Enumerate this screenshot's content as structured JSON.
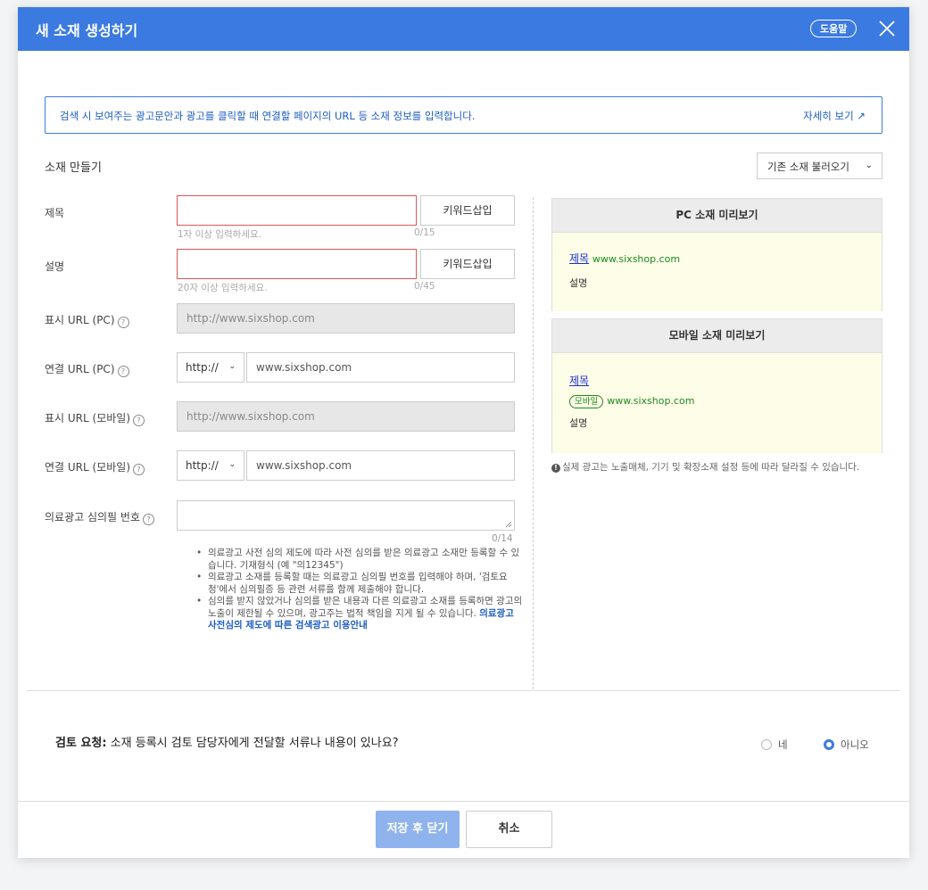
{
  "header": {
    "title": "새 소재 생성하기",
    "help_label": "도움말"
  },
  "info": {
    "text": "검색 시 보여주는 광고문안과 광고를 클릭할 때 연결할 페이지의 URL 등 소재 정보를 입력합니다.",
    "more_label": "자세히 보기 ↗"
  },
  "section": {
    "title": "소재 만들기",
    "import_label": "기존 소재 불러오기"
  },
  "form": {
    "title": {
      "label": "제목",
      "value": "",
      "hint": "1자 이상 입력하세요.",
      "count": "0/15",
      "keyword_btn": "키워드삽입"
    },
    "description": {
      "label": "설명",
      "value": "",
      "hint": "20자 이상 입력하세요.",
      "count": "0/45",
      "keyword_btn": "키워드삽입"
    },
    "display_url_pc": {
      "label": "표시 URL (PC)",
      "value": "http://www.sixshop.com"
    },
    "link_url_pc": {
      "label": "연결 URL (PC)",
      "protocol": "http://",
      "value": "www.sixshop.com"
    },
    "display_url_mobile": {
      "label": "표시 URL (모바일)",
      "value": "http://www.sixshop.com"
    },
    "link_url_mobile": {
      "label": "연결 URL (모바일)",
      "protocol": "http://",
      "value": "www.sixshop.com"
    },
    "medical": {
      "label": "의료광고 심의필 번호",
      "value": "",
      "count": "0/14"
    },
    "bullets": [
      "의료광고 사전 심의 제도에 따라 사전 심의를 받은 의료광고 소재만 등록할 수 있습니다. 기재형식 (예 \"의12345\")",
      "의료광고 소재를 등록할 때는 의료광고 심의필 번호를 입력해야 하며, '검토요청'에서 심의필증 등 관련 서류를 함께 제출해야 합니다.",
      "심의를 받지 않았거나 심의를 받은 내용과 다른 의료광고 소재를 등록하면 광고의 노출이 제한될 수 있으며, 광고주는 법적 책임을 지게 될 수 있습니다. "
    ],
    "bullet_link": "의료광고 사전심의 제도에 따른 검색광고 이용안내"
  },
  "preview": {
    "pc": {
      "header": "PC 소재 미리보기",
      "title": "제목",
      "url": "www.sixshop.com",
      "desc": "설명"
    },
    "mobile": {
      "header": "모바일 소재 미리보기",
      "title": "제목",
      "badge": "모바일",
      "url": "www.sixshop.com",
      "desc": "설명"
    },
    "note": "실제 광고는 노출매체, 기기 및 확장소재 설정 등에 따라 달라질 수 있습니다."
  },
  "review": {
    "label": "검토 요청:",
    "question": " 소재 등록시 검토 담당자에게 전달할 서류나 내용이 있나요?",
    "options": [
      "네",
      "아니오"
    ],
    "selected": "아니오"
  },
  "footer": {
    "save_label": "저장 후 닫기",
    "cancel_label": "취소"
  },
  "colors": {
    "primary": "#3b7ae0",
    "error": "#e05656",
    "link": "#1e5dc1"
  }
}
